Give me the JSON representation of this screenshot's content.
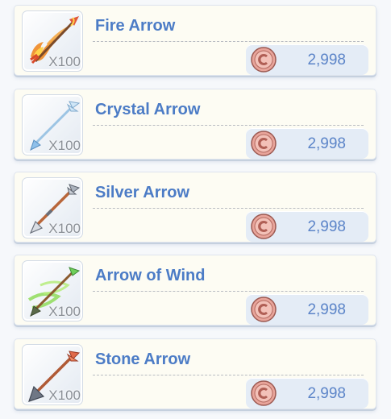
{
  "shop": {
    "items": [
      {
        "name": "Fire Arrow",
        "quantity": "X100",
        "price": "2,998",
        "icon": "fire-arrow-icon"
      },
      {
        "name": "Crystal Arrow",
        "quantity": "X100",
        "price": "2,998",
        "icon": "crystal-arrow-icon"
      },
      {
        "name": "Silver Arrow",
        "quantity": "X100",
        "price": "2,998",
        "icon": "silver-arrow-icon"
      },
      {
        "name": "Arrow of Wind",
        "quantity": "X100",
        "price": "2,998",
        "icon": "wind-arrow-icon"
      },
      {
        "name": "Stone Arrow",
        "quantity": "X100",
        "price": "2,998",
        "icon": "stone-arrow-icon"
      }
    ],
    "currency_icon": "coin-icon",
    "colors": {
      "title": "#4c7cc6",
      "price": "#5b84c8",
      "card_background": "#fdfcf3",
      "price_button": "#e4ecf6",
      "coin": "#e8a49a"
    }
  }
}
